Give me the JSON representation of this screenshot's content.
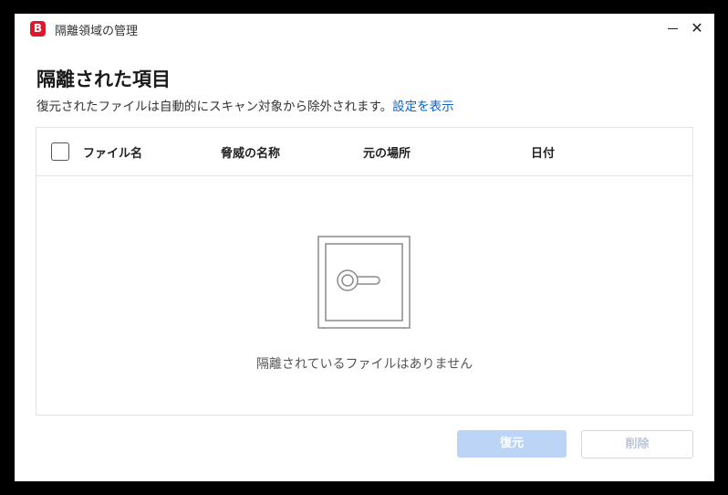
{
  "window": {
    "app_logo": "B",
    "title": "隔離領域の管理",
    "minimize_icon": "minimize-icon",
    "close_glyph": "✕"
  },
  "main": {
    "title": "隔離された項目",
    "description": "復元されたファイルは自動的にスキャン対象から除外されます。",
    "settings_link": "設定を表示"
  },
  "table": {
    "columns": [
      "ファイル名",
      "脅威の名称",
      "元の場所",
      "日付"
    ],
    "rows": [],
    "empty_icon": "safe-icon",
    "empty_message": "隔離されているファイルはありません"
  },
  "buttons": {
    "restore": "復元",
    "delete": "削除"
  },
  "colors": {
    "brand": "#e2172d",
    "link": "#0a63c8",
    "button_disabled_primary": "#bcd4f6"
  }
}
